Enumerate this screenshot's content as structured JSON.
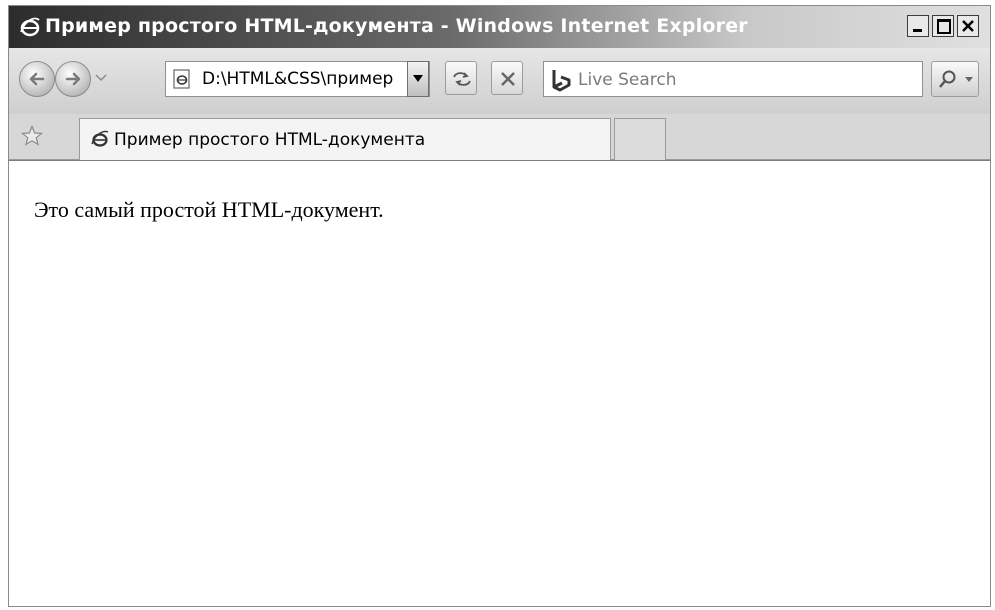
{
  "window": {
    "title": "Пример простого HTML-документа - Windows Internet Explorer"
  },
  "navigation": {
    "address": "D:\\HTML&CSS\\пример",
    "search_placeholder": "Live Search"
  },
  "tabs": [
    {
      "label": "Пример простого HTML-документа"
    }
  ],
  "content": {
    "text": "Это самый простой HTML-документ."
  },
  "icons": {
    "app": "ie-logo-icon",
    "back": "back-arrow-icon",
    "forward": "forward-arrow-icon",
    "favorites": "star-icon",
    "search": "magnifier-icon",
    "search_provider": "bing-icon"
  }
}
